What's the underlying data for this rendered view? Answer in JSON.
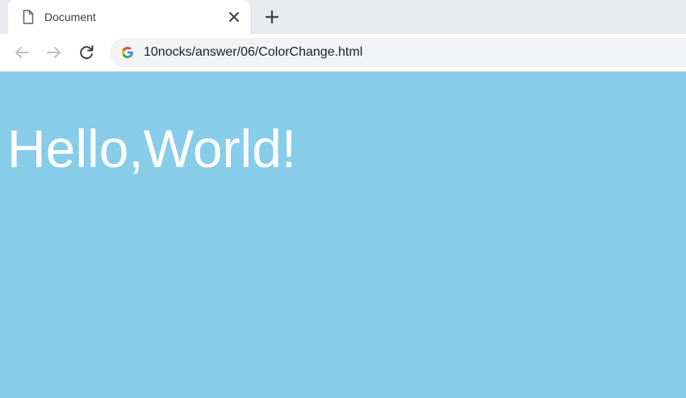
{
  "tab": {
    "title": "Document",
    "icon": "document-icon",
    "close_icon": "close-icon"
  },
  "tabstrip": {
    "new_tab_icon": "plus-icon"
  },
  "toolbar": {
    "back_icon": "arrow-left-icon",
    "forward_icon": "arrow-right-icon",
    "reload_icon": "reload-icon",
    "omnibox_icon": "google-g-icon",
    "url": "10nocks/answer/06/ColorChange.html"
  },
  "page": {
    "background_color": "#87cdea",
    "text_color": "#ffffff",
    "heading": "Hello,World!"
  }
}
